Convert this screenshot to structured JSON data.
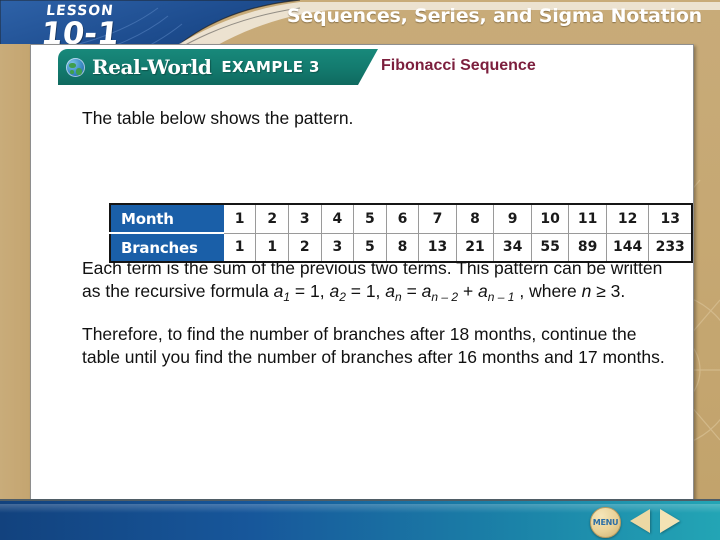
{
  "header": {
    "lesson_word": "LESSON",
    "lesson_number": "10-1",
    "chapter_title": "Sequences, Series, and Sigma Notation"
  },
  "example_banner": {
    "globe_icon": "globe-icon",
    "real_world_label": "Real-World",
    "example_label": "EXAMPLE 3",
    "title": "Fibonacci Sequence",
    "banner_color": "#14796e",
    "title_color": "#7c1f3d"
  },
  "content": {
    "intro": "The table below shows the pattern.",
    "paragraph1": {
      "part_a": "Each term is the sum of the previous two terms. This pattern can be written as the recursive formula ",
      "a1": "a",
      "a1_sub": "1",
      "eq1": " = 1,",
      "a2": "a",
      "a2_sub": "2",
      "eq2": " = 1, ",
      "an": "a",
      "an_sub": "n",
      "eq3": " = ",
      "anm2": "a",
      "anm2_sub": "n – 2",
      "plus": " + ",
      "anm1": "a",
      "anm1_sub": "n – 1",
      "tail_a": " , where ",
      "n_italic": "n",
      "tail_b": " ≥ 3."
    },
    "paragraph2": "Therefore, to find the number of branches after 18 months, continue the table until you find the number of branches after 16 months and 17 months."
  },
  "table": {
    "row_labels": [
      "Month",
      "Branches"
    ],
    "months": [
      "1",
      "2",
      "3",
      "4",
      "5",
      "6",
      "7",
      "8",
      "9",
      "10",
      "11",
      "12",
      "13"
    ],
    "branches": [
      "1",
      "1",
      "2",
      "3",
      "5",
      "8",
      "13",
      "21",
      "34",
      "55",
      "89",
      "144",
      "233"
    ],
    "header_color": "#1a5fa8"
  },
  "footer": {
    "menu_label": "MENU",
    "prev_icon": "triangle-left-icon",
    "next_icon": "triangle-right-icon"
  }
}
